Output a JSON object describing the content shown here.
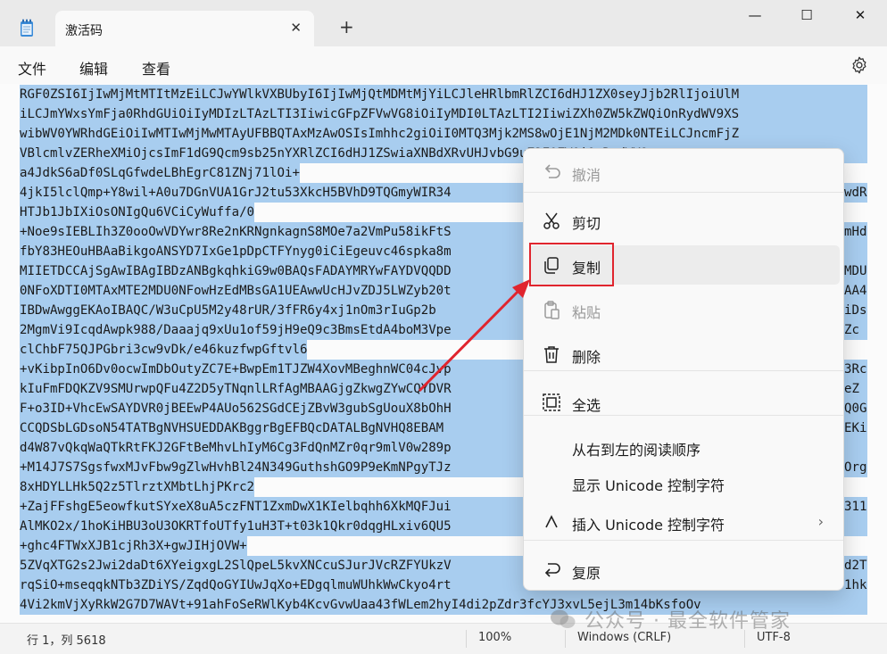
{
  "tab": {
    "title": "激活码",
    "close": "✕",
    "new": "+"
  },
  "window": {
    "minimize": "—",
    "maximize": "☐",
    "close": "✕"
  },
  "menu": {
    "file": "文件",
    "edit": "编辑",
    "view": "查看"
  },
  "editor_lines": [
    "RGF0ZSI6IjIwMjMtMTItMzEiLCJwYWlkVXBUbyI6IjIwMjQtMDMtMjYiLCJleHRlbmRlZCI6dHJ1ZX0seyJjb2RlIjoiUlM",
    "iLCJmYWxsYmFja0RhdGUiOiIyMDIzLTAzLTI3IiwicGFpZFVwVG8iOiIyMDI0LTAzLTI2IiwiZXh0ZW5kZWQiOnRydWV9XS",
    "wibWV0YWRhdGEiOiIwMTIwMjMwMTAyUFBBQTAxMzAwOSIsImhhc2giOiI0MTQ3Mjk2MS8wOjE1NjM2MDk0NTEiLCJncmFjZ",
    "VBlcmlvZERheXMiOjcsImF1dG9Qcm9sb25nYXRlZCI6dHJ1ZSwiaXNBdXRvUHJvbG9uZ2F0ZWQiOnRydWV9",
    "a4JdkS6aDf0SLqGfwdeLBhEgrC81ZNj71lOi+",
    "4jkI5lclQmp+Y8wil+A0u7DGnVUA1GrJ2tu53XkcH5BVhD9TQGmyWIR34",
    "HTJb1JbIXiOsONIgQu6VCiCyWuffa/0",
    "+Noe9sIEBLIh3Z0ooOwVDYwr8Re2nKRNgnkagnS8MOe7a2VmPu58ikFtS",
    "fbY83HEOuHBAaBikgoANSYD7IxGe1pDpCTFYnyg0iCiEgeuvc46spka8m",
    "MIIETDCCAjSgAwIBAgIBDzANBgkqhkiG9w0BAQsFADAYMRYwFAYDVQQDD",
    "0NFoXDTI0MTAxMTE2MDU0NFowHzEdMBsGA1UEAwwUcHJvZDJ5LWZyb20t",
    "IBDwAwggEKAoIBAQC/W3uCpU5M2y48rUR/3fFR6y4xj1nOm3rIuGp2b",
    "2MgmVi9IcqdAwpk988/Daaajq9xUu1of59jH9eQ9c3BmsEtdA4boM3Vpe",
    "clChbF75QJPGbri3cw9vDk/e46kuzfwpGftvl6",
    "+vKibpInO6Dv0ocwImDbOutyZC7E+BwpEm1TJZW4XovMBeghnWC04cJvp",
    "kIuFmFDQKZV9SMUrwpQFu4Z2D5yTNqnlLRfAgMBAAGjgZkwgZYwCQYDVR",
    "F+o3ID+VhcEwSAYDVR0jBEEwP4AUo562SGdCEjZBvW3gubSgUouX8bOhH",
    "CCQDSbLGDsoN54TATBgNVHSUEDDAKBggrBgEFBQcDATALBgNVHQ8EBAM",
    "d4W87vQkqWaQTkRtFKJ2GFtBeMhvLhIyM6Cg3FdQnMZr0qr9mlV0w289p",
    "+M14J7S7SgsfwxMJvFbw9gZlwHvhBl24N349GuthshGO9P9eKmNPgyTJz",
    "8xHDYLLHk5Q2z5TlrztXMbtLhjPKrc2",
    "+ZajFFshgE5eowfkutSYxeX8uA5czFNT1ZxmDwX1KIelbqhh6XkMQFJui",
    "AlMKO2x/1hoKiHBU3oU3OKRTfoUTfy1uH3T+t03k1Qkr0dqgHLxiv6QU5",
    "+ghc4FTWxXJB1cjRh3X+gwJIHjOVW+",
    "5ZVqXTG2s2Jwi2daDt6XYeigxgL2SlQpeL5kvXNCcuSJurJVcRZFYUkzV",
    "rqSiO+mseqqkNTb3ZDiYS/ZqdQoGYIUwJqXo+EDgqlmuWUhkWwCkyo4rt",
    "4Vi2kmVjXyRkW2G7D7WAVt+91ahFoSeRWlKyb4KcvGvwUaa43fWLem2hyI4di2pZdr3fcYJ3xvL5ejL3m14bKsfoOv"
  ],
  "editor_right_tails": [
    "",
    "",
    "",
    "",
    "",
    "wdR",
    "",
    "mHd",
    "",
    "MDU",
    "AA4",
    "iDs",
    "Zc",
    "",
    "3Rc",
    "eZ",
    "Q0G",
    "EKi",
    "",
    "Org",
    "",
    "311",
    "",
    "",
    "d2T",
    "1hk",
    ""
  ],
  "context_menu": {
    "items": [
      {
        "label": "撤消",
        "icon": "undo-icon",
        "disabled": true
      },
      {
        "label": "剪切",
        "icon": "cut-icon",
        "disabled": false
      },
      {
        "label": "复制",
        "icon": "copy-icon",
        "disabled": false
      },
      {
        "label": "粘贴",
        "icon": "paste-icon",
        "disabled": true
      },
      {
        "label": "删除",
        "icon": "delete-icon",
        "disabled": false
      },
      {
        "label": "全选",
        "icon": "select-all-icon",
        "disabled": false
      },
      {
        "label": "从右到左的阅读顺序",
        "icon": "",
        "disabled": false
      },
      {
        "label": "显示 Unicode 控制字符",
        "icon": "",
        "disabled": false
      },
      {
        "label": "插入 Unicode 控制字符",
        "icon": "insert-icon",
        "disabled": false
      },
      {
        "label": "复原",
        "icon": "reconvert-icon",
        "disabled": false
      }
    ],
    "submenu_arrow": "›"
  },
  "status": {
    "position": "行 1，列 5618",
    "zoom": "100%",
    "line_ending": "Windows (CRLF)",
    "encoding": "UTF-8"
  },
  "watermark": "公众号 · 最全软件管家",
  "colors": {
    "selection": "#a8cdef",
    "highlight": "#e0252e"
  }
}
